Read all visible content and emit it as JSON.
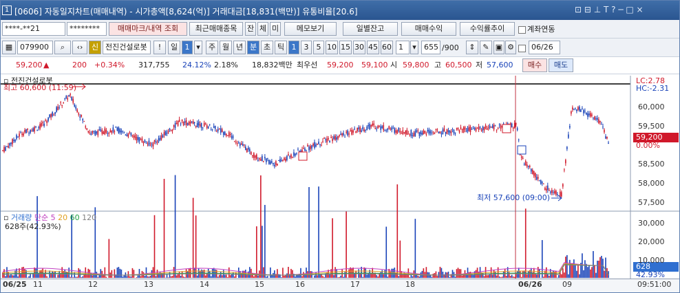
{
  "window": {
    "num": "1",
    "title": "[0606] 자동일지차트(매매내역) - 시가총액[8,624(억)] 거래대금[18,831(백만)] 유통비율[20.6]",
    "controls": "⊡ ⊟ ⊥ T ?   ─ □ ×"
  },
  "row1": {
    "account": "****-**21",
    "password": "********",
    "btn_trade": "매매마크/내역 조회",
    "btn_recent": "최근매매종목",
    "btn_jan": "잔",
    "btn_che": "체",
    "btn_mi": "미",
    "btn_memo": "메모보기",
    "btn_daily": "일별잔고",
    "btn_profit": "매매수익",
    "btn_rate": "수익률추이",
    "chk_link": "계좌연동"
  },
  "row2": {
    "code": "079900",
    "sin": "신",
    "stock": "전진건설로봇",
    "warn": "!",
    "period": [
      "일",
      "1",
      "주",
      "월",
      "년",
      "분",
      "초",
      "틱"
    ],
    "ticks": [
      "1",
      "3",
      "5",
      "10",
      "15",
      "30",
      "45",
      "60",
      "1"
    ],
    "count": "655",
    "total": "/900",
    "date": "06/26"
  },
  "row3": {
    "price": "59,200",
    "arrow": "▲",
    "change": "200",
    "pct": "+0.34%",
    "volume": "317,755",
    "vol_pct": "24.12%",
    "turn": "2.18%",
    "amount": "18,832백만",
    "best": "최우선",
    "ask": "59,200",
    "bid": "59,100",
    "open_lbl": "시",
    "open": "59,800",
    "high_lbl": "고",
    "high": "60,500",
    "low_lbl": "저",
    "low": "57,600",
    "buy": "매수",
    "sell": "매도"
  },
  "chart": {
    "stock_label": "전진건설로봇",
    "max_label": "최고 60,600 (11:59)",
    "min_label": "최저 57,600 (09:00)",
    "lc": "LC:2.78",
    "hc": "HC:-2.31",
    "price_tag": "59,200",
    "pct_tag": "0.00%",
    "vol_tag": "628",
    "vol_pct_tag": "42.93%",
    "y_labels": [
      "60,000",
      "59,500",
      "59,000",
      "58,500",
      "58,000",
      "57,500"
    ],
    "vol_labels": [
      "30,000",
      "20,000",
      "10,000"
    ],
    "vol_legend": "거래량",
    "ma_legend": "단순",
    "ma": [
      "5",
      "20",
      "60",
      "120"
    ],
    "vol_info": "628주(42.93%)",
    "x_labels": [
      "06/25",
      "11",
      "12",
      "13",
      "14",
      "15",
      "16",
      "17",
      "18",
      "06/26",
      "09"
    ],
    "time": "09:51:00",
    "colors": {
      "up": "#d0182a",
      "down": "#1842b8",
      "ma5": "#c040c0",
      "ma20": "#e0a020",
      "ma60": "#20a040",
      "ma120": "#808080"
    }
  }
}
